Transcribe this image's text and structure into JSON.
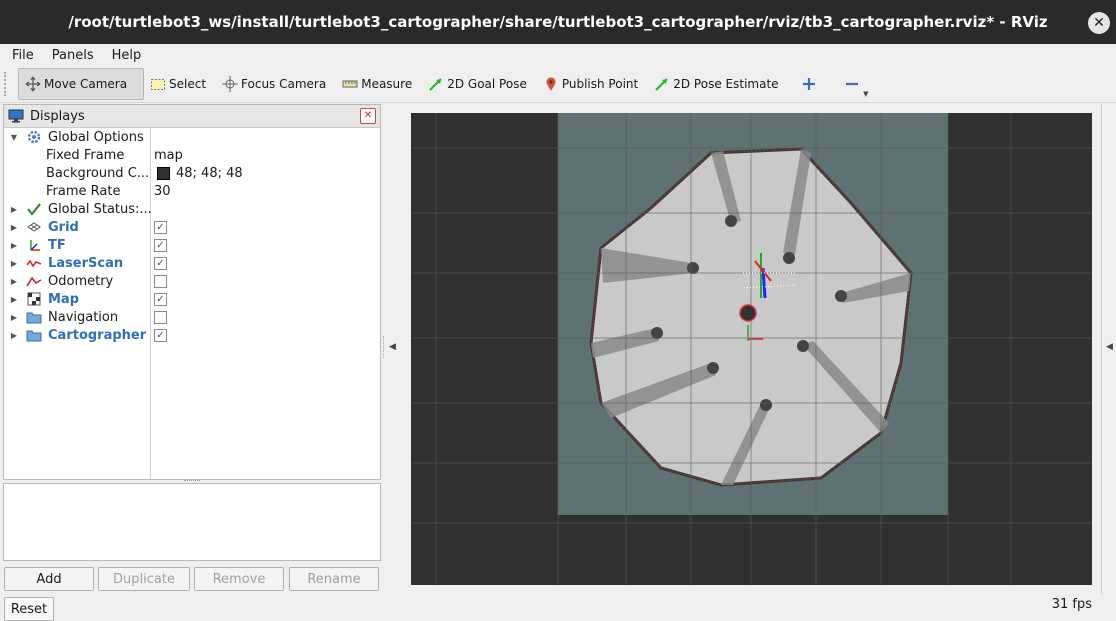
{
  "window": {
    "title": "/root/turtlebot3_ws/install/turtlebot3_cartographer/share/turtlebot3_cartographer/rviz/tb3_cartographer.rviz* - RViz",
    "close_glyph": "✕"
  },
  "menu": [
    "File",
    "Panels",
    "Help"
  ],
  "toolbar": {
    "tools": [
      {
        "label": "Move Camera",
        "icon": "move-camera-icon",
        "active": true
      },
      {
        "label": "Select",
        "icon": "select-icon"
      },
      {
        "label": "Focus Camera",
        "icon": "focus-camera-icon"
      },
      {
        "label": "Measure",
        "icon": "measure-icon"
      },
      {
        "label": "2D Goal Pose",
        "icon": "goal-arrow-icon"
      },
      {
        "label": "Publish Point",
        "icon": "map-pin-icon"
      },
      {
        "label": "2D Pose Estimate",
        "icon": "pose-arrow-icon"
      }
    ],
    "add_icon": "plus-icon",
    "remove_icon": "minus-icon"
  },
  "displays": {
    "title": "Displays",
    "global_options": "Global Options",
    "fixed_frame_label": "Fixed Frame",
    "fixed_frame_value": "map",
    "background_label": "Background C...",
    "background_value": "48; 48; 48",
    "background_color": "#303030",
    "frame_rate_label": "Frame Rate",
    "frame_rate_value": "30",
    "global_status": "Global Status:...",
    "items": [
      {
        "label": "Grid",
        "bold": true,
        "checked": true
      },
      {
        "label": "TF",
        "bold": true,
        "checked": true
      },
      {
        "label": "LaserScan",
        "bold": true,
        "checked": true
      },
      {
        "label": "Odometry",
        "bold": false,
        "checked": false
      },
      {
        "label": "Map",
        "bold": true,
        "checked": true
      },
      {
        "label": "Navigation",
        "bold": false,
        "checked": false
      },
      {
        "label": "Cartographer",
        "bold": true,
        "checked": true
      }
    ]
  },
  "buttons": {
    "add": "Add",
    "duplicate": "Duplicate",
    "remove": "Remove",
    "rename": "Rename",
    "reset": "Reset"
  },
  "status": {
    "fps": "31 fps"
  }
}
